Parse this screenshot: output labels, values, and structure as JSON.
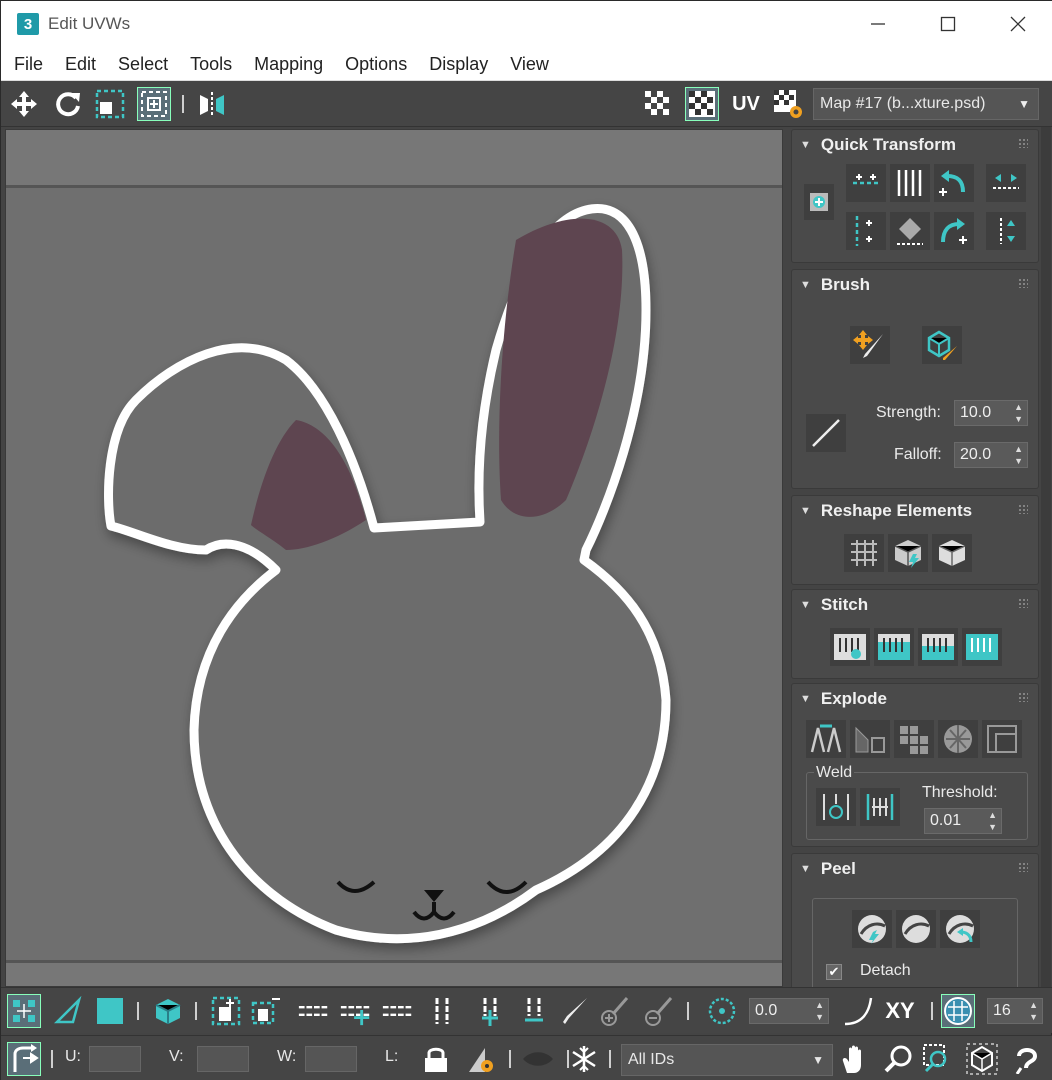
{
  "window": {
    "title": "Edit UVWs",
    "logo_glyph": "3"
  },
  "menu": [
    "File",
    "Edit",
    "Select",
    "Tools",
    "Mapping",
    "Options",
    "Display",
    "View"
  ],
  "toolbar": {
    "uv_label": "UV",
    "map_select": "Map #17 (b...xture.psd)"
  },
  "panel": {
    "quick_transform": {
      "title": "Quick Transform"
    },
    "brush": {
      "title": "Brush",
      "strength_label": "Strength:",
      "strength_value": "10.0",
      "falloff_label": "Falloff:",
      "falloff_value": "20.0"
    },
    "reshape": {
      "title": "Reshape Elements"
    },
    "stitch": {
      "title": "Stitch"
    },
    "explode": {
      "title": "Explode",
      "weld_label": "Weld",
      "threshold_label": "Threshold:",
      "threshold_value": "0.01"
    },
    "peel": {
      "title": "Peel",
      "detach_label": "Detach"
    }
  },
  "bottom": {
    "rotate_value": "0.0",
    "xy_label": "XY",
    "grid_value": "16",
    "u_label": "U:",
    "v_label": "V:",
    "w_label": "W:",
    "l_label": "L:",
    "ids_select": "All IDs"
  },
  "colors": {
    "accent": "#3fc6c6",
    "panel_bg": "#444444",
    "viewport_bg": "#6f6f6f",
    "uv_shell_fill": "#6a6a6a",
    "ear_inner": "#5e4550",
    "outline": "#ffffff"
  }
}
